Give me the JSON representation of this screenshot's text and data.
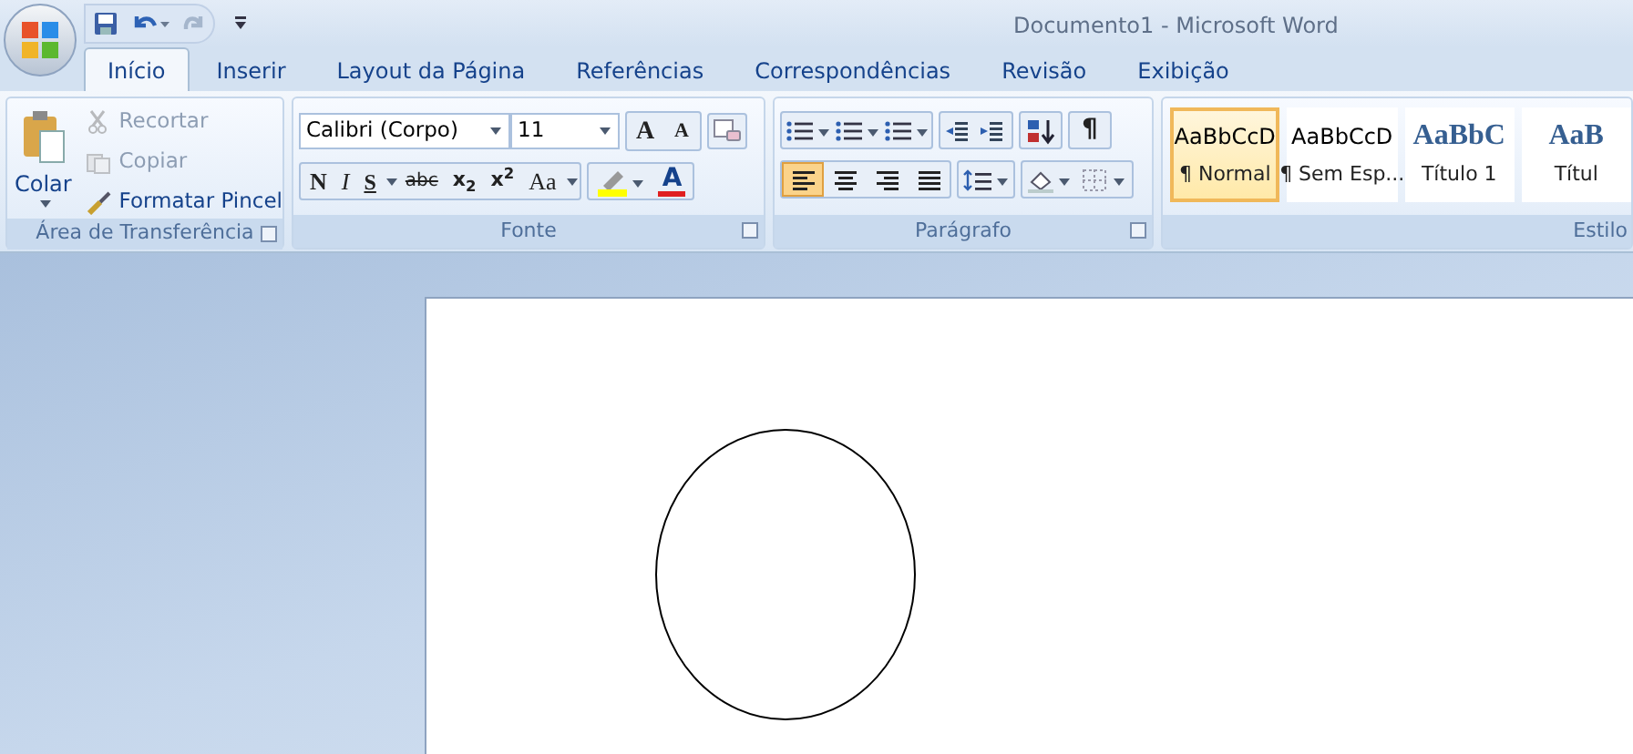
{
  "window": {
    "title": "Documento1 - Microsoft Word"
  },
  "tabs": [
    {
      "label": "Início",
      "selected": true
    },
    {
      "label": "Inserir",
      "selected": false
    },
    {
      "label": "Layout da Página",
      "selected": false
    },
    {
      "label": "Referências",
      "selected": false
    },
    {
      "label": "Correspondências",
      "selected": false
    },
    {
      "label": "Revisão",
      "selected": false
    },
    {
      "label": "Exibição",
      "selected": false
    }
  ],
  "clipboard": {
    "paste_label": "Colar",
    "items": [
      {
        "label": "Recortar",
        "disabled": true
      },
      {
        "label": "Copiar",
        "disabled": true
      },
      {
        "label": "Formatar Pincel",
        "disabled": false
      }
    ],
    "title": "Área de Transferência"
  },
  "font": {
    "name": "Calibri (Corpo)",
    "size": "11",
    "size_buttons": [
      "A",
      "A"
    ],
    "format_buttons": [
      {
        "label": "N",
        "kind": "bold"
      },
      {
        "label": "I",
        "kind": "italic"
      },
      {
        "label": "S",
        "kind": "underline"
      },
      {
        "label": "abc",
        "kind": "strike"
      },
      {
        "label": "x$_{2}$",
        "kind": "sub"
      },
      {
        "label": "x$^{2}$",
        "kind": "sup"
      },
      {
        "label": "Aa",
        "kind": "case"
      }
    ],
    "color_button": "A",
    "title": "Fonte"
  },
  "paragraph": {
    "pilcrow": "¶",
    "alignments": [
      {
        "selected": true
      },
      {
        "selected": false
      },
      {
        "selected": false
      },
      {
        "selected": false
      }
    ],
    "title": "Parágrafo"
  },
  "styles": {
    "items": [
      {
        "preview": "AaBbCcD",
        "name": "¶ Normal",
        "kind": "body",
        "selected": true
      },
      {
        "preview": "AaBbCcD",
        "name": "¶ Sem Esp...",
        "kind": "body",
        "selected": false
      },
      {
        "preview": "AaBbC",
        "name": "Título 1",
        "kind": "heading",
        "selected": false
      },
      {
        "preview": "AaB",
        "name": "Títul",
        "kind": "heading",
        "selected": false
      }
    ],
    "title": "Estilo"
  }
}
